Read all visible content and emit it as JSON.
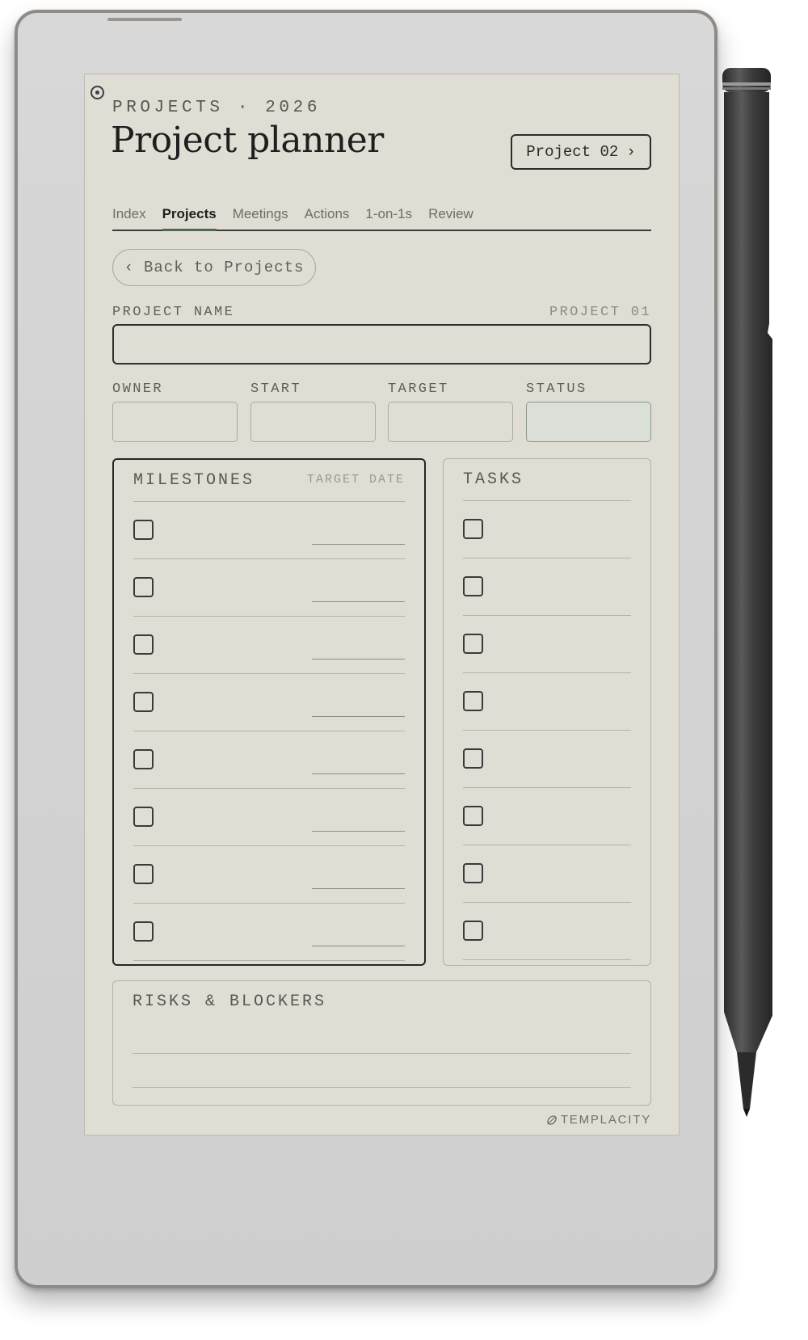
{
  "header": {
    "eyebrow": "PROJECTS · 2026",
    "title": "Project planner",
    "next_project_label": "Project 02",
    "next_icon": "›"
  },
  "tabs": [
    {
      "label": "Index",
      "active": false
    },
    {
      "label": "Projects",
      "active": true
    },
    {
      "label": "Meetings",
      "active": false
    },
    {
      "label": "Actions",
      "active": false
    },
    {
      "label": "1-on-1s",
      "active": false
    },
    {
      "label": "Review",
      "active": false
    }
  ],
  "back_button": {
    "icon": "‹",
    "label": "Back to Projects"
  },
  "form": {
    "project_name_label": "PROJECT NAME",
    "project_number": "PROJECT 01",
    "owner_label": "OWNER",
    "start_label": "START",
    "target_label": "TARGET",
    "status_label": "STATUS"
  },
  "milestones": {
    "title": "MILESTONES",
    "subtitle": "TARGET DATE",
    "row_count": 8
  },
  "tasks": {
    "title": "TASKS",
    "row_count": 8
  },
  "risks": {
    "title": "RISKS & BLOCKERS"
  },
  "brand": {
    "name": "TEMPLACITY",
    "icon": "leaf-icon"
  },
  "colors": {
    "paper": "#e0ddd4",
    "accent": "#4f6a52",
    "ink": "#1e1e1e",
    "device": "#d3d3d3"
  }
}
